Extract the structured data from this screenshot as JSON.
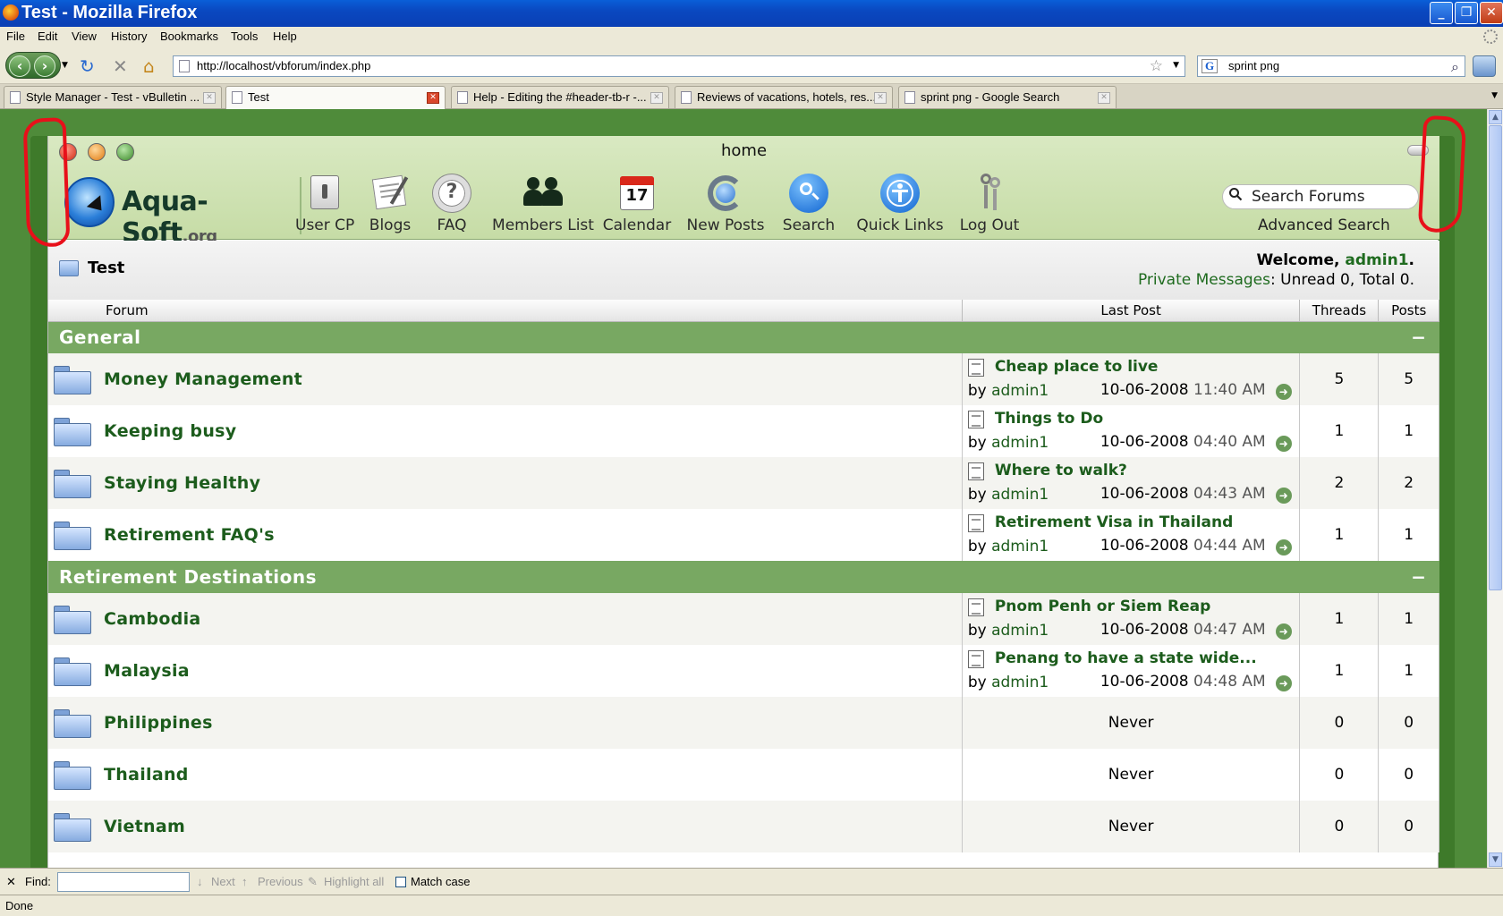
{
  "window": {
    "title": "Test - Mozilla Firefox"
  },
  "menu": [
    "File",
    "Edit",
    "View",
    "History",
    "Bookmarks",
    "Tools",
    "Help"
  ],
  "nav": {
    "url": "http://localhost/vbforum/index.php",
    "search_query": "sprint png"
  },
  "tabs": [
    {
      "label": "Style Manager - Test - vBulletin ..."
    },
    {
      "label": "Test",
      "active": true
    },
    {
      "label": "Help - Editing the #header-tb-r -..."
    },
    {
      "label": "Reviews of vacations, hotels, res..."
    },
    {
      "label": "sprint png - Google Search"
    }
  ],
  "forum_header": {
    "window_title": "home",
    "logo_main": "Aqua-Soft",
    "logo_suffix": ".org",
    "nav_items": [
      {
        "label": "User CP",
        "icon": "user-cp-icon"
      },
      {
        "label": "Blogs",
        "icon": "blogs-icon"
      },
      {
        "label": "FAQ",
        "icon": "faq-icon"
      },
      {
        "label": "Members List",
        "icon": "members-icon"
      },
      {
        "label": "Calendar",
        "icon": "calendar-icon",
        "day": "17"
      },
      {
        "label": "New Posts",
        "icon": "new-posts-icon"
      },
      {
        "label": "Search",
        "icon": "search-icon"
      },
      {
        "label": "Quick Links",
        "icon": "quick-links-icon"
      },
      {
        "label": "Log Out",
        "icon": "logout-icon"
      }
    ],
    "search_placeholder": "Search Forums",
    "advanced_search": "Advanced Search"
  },
  "welcome": {
    "forum_title": "Test",
    "welcome_prefix": "Welcome, ",
    "username": "admin1",
    "welcome_suffix": ".",
    "pm_link": "Private Messages",
    "pm_stats": ": Unread 0, Total 0."
  },
  "table": {
    "headers": {
      "forum": "Forum",
      "last_post": "Last Post",
      "threads": "Threads",
      "posts": "Posts"
    },
    "categories": [
      {
        "name": "General",
        "collapse": "−",
        "forums": [
          {
            "name": "Money Management",
            "last_title": "Cheap place to live",
            "by": "by ",
            "user": "admin1",
            "date": "10-06-2008",
            "time": "11:40 AM",
            "threads": "5",
            "posts": "5"
          },
          {
            "name": "Keeping busy",
            "last_title": "Things to Do",
            "by": "by ",
            "user": "admin1",
            "date": "10-06-2008",
            "time": "04:40 AM",
            "threads": "1",
            "posts": "1"
          },
          {
            "name": "Staying Healthy",
            "last_title": "Where to walk?",
            "by": "by ",
            "user": "admin1",
            "date": "10-06-2008",
            "time": "04:43 AM",
            "threads": "2",
            "posts": "2"
          },
          {
            "name": "Retirement FAQ's",
            "last_title": "Retirement Visa in Thailand",
            "by": "by ",
            "user": "admin1",
            "date": "10-06-2008",
            "time": "04:44 AM",
            "threads": "1",
            "posts": "1"
          }
        ]
      },
      {
        "name": "Retirement Destinations",
        "collapse": "−",
        "forums": [
          {
            "name": "Cambodia",
            "last_title": "Pnom Penh or Siem Reap",
            "by": "by ",
            "user": "admin1",
            "date": "10-06-2008",
            "time": "04:47 AM",
            "threads": "1",
            "posts": "1"
          },
          {
            "name": "Malaysia",
            "last_title": "Penang to have a state wide...",
            "by": "by ",
            "user": "admin1",
            "date": "10-06-2008",
            "time": "04:48 AM",
            "threads": "1",
            "posts": "1"
          },
          {
            "name": "Philippines",
            "never": "Never",
            "threads": "0",
            "posts": "0"
          },
          {
            "name": "Thailand",
            "never": "Never",
            "threads": "0",
            "posts": "0"
          },
          {
            "name": "Vietnam",
            "never": "Never",
            "threads": "0",
            "posts": "0"
          }
        ]
      }
    ]
  },
  "findbar": {
    "close": "✕",
    "label": "Find:",
    "next": "Next",
    "previous": "Previous",
    "highlight": "Highlight all",
    "match_case": "Match case"
  },
  "status": "Done"
}
